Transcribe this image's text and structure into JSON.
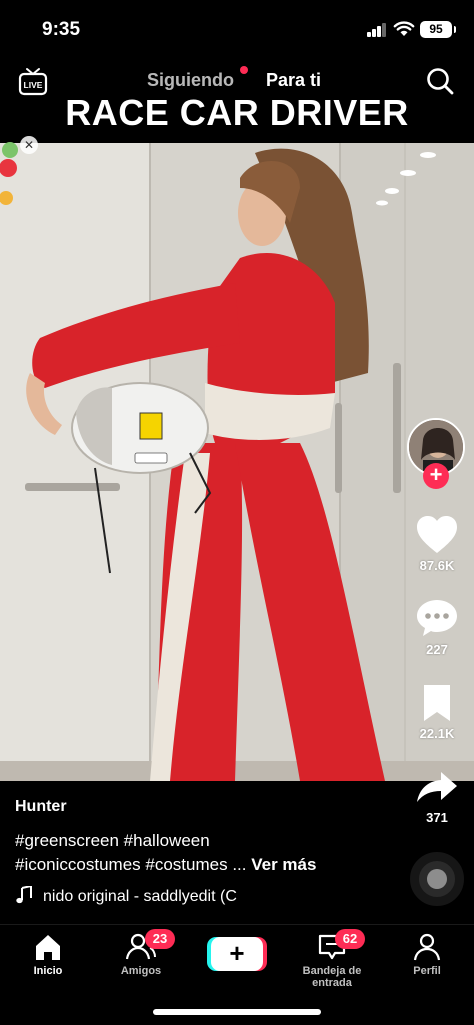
{
  "status_bar": {
    "time": "9:35",
    "battery": "95"
  },
  "top_nav": {
    "live_label": "LIVE",
    "following_label": "Siguiendo",
    "for_you_label": "Para ti"
  },
  "overlay_title": "RACE CAR DRIVER",
  "actions": {
    "likes": "87.6K",
    "comments": "227",
    "bookmarks": "22.1K",
    "shares": "371"
  },
  "caption": {
    "username": "Hunter",
    "line1": "#greenscreen #halloween",
    "line2": "#iconiccostumes #costumes ...",
    "more_label": "Ver más",
    "sound": "nido original - saddlyedit (C"
  },
  "tabbar": {
    "home": "Inicio",
    "friends": "Amigos",
    "friends_badge": "23",
    "inbox": "Bandeja de entrada",
    "inbox_badge": "62",
    "profile": "Perfil",
    "create": "+"
  },
  "colors": {
    "accent": "#fe2c55",
    "cyan": "#25f4ee",
    "suit_red": "#d8232a"
  }
}
